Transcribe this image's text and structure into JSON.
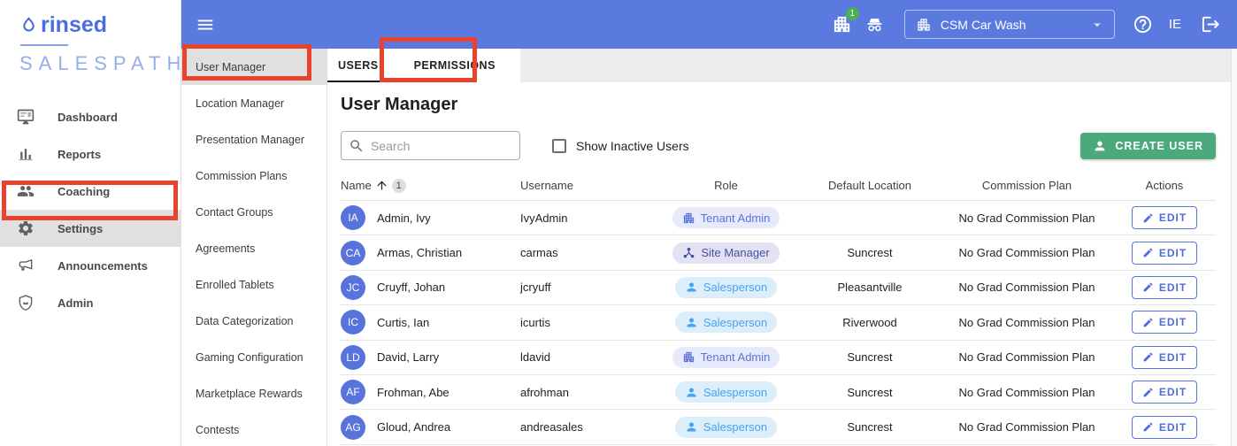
{
  "brand": {
    "name": "rinsed",
    "subtitle": "SALESPATH"
  },
  "sidebar": {
    "items": [
      {
        "id": "dashboard",
        "label": "Dashboard",
        "icon": "dashboard",
        "active": false
      },
      {
        "id": "reports",
        "label": "Reports",
        "icon": "reports",
        "active": false
      },
      {
        "id": "coaching",
        "label": "Coaching",
        "icon": "coaching",
        "active": false
      },
      {
        "id": "settings",
        "label": "Settings",
        "icon": "settings",
        "active": true,
        "annotated": true
      },
      {
        "id": "announcements",
        "label": "Announcements",
        "icon": "announcements",
        "active": false
      },
      {
        "id": "admin",
        "label": "Admin",
        "icon": "admin",
        "active": false
      }
    ]
  },
  "submenu": {
    "items": [
      {
        "id": "user-manager",
        "label": "User Manager",
        "active": true,
        "annotated": true
      },
      {
        "id": "location-manager",
        "label": "Location Manager",
        "active": false
      },
      {
        "id": "presentation-manager",
        "label": "Presentation Manager",
        "active": false
      },
      {
        "id": "commission-plans",
        "label": "Commission Plans",
        "active": false
      },
      {
        "id": "contact-groups",
        "label": "Contact Groups",
        "active": false
      },
      {
        "id": "agreements",
        "label": "Agreements",
        "active": false
      },
      {
        "id": "enrolled-tablets",
        "label": "Enrolled Tablets",
        "active": false
      },
      {
        "id": "data-categorization",
        "label": "Data Categorization",
        "active": false
      },
      {
        "id": "gaming-configuration",
        "label": "Gaming Configuration",
        "active": false
      },
      {
        "id": "marketplace-rewards",
        "label": "Marketplace Rewards",
        "active": false
      },
      {
        "id": "contests",
        "label": "Contests",
        "active": false
      }
    ]
  },
  "topbar": {
    "badge_count": "1",
    "tenant_selector": {
      "value": "CSM Car Wash"
    },
    "user_initials": "IE"
  },
  "tabs": [
    {
      "label": "USERS",
      "active": true
    },
    {
      "label": "PERMISSIONS",
      "active": false,
      "annotated": true
    }
  ],
  "page": {
    "title": "User Manager",
    "search_placeholder": "Search",
    "show_inactive_label": "Show Inactive Users",
    "show_inactive_checked": false,
    "create_user_label": "CREATE USER"
  },
  "table": {
    "columns": [
      "Name",
      "Username",
      "Role",
      "Default Location",
      "Commission Plan",
      "Actions"
    ],
    "sort": {
      "column": "Name",
      "direction": "asc",
      "order": "1"
    },
    "edit_label": "EDIT",
    "role_icons": {
      "tenant-admin": "building",
      "site-manager": "hierarchy",
      "salesperson": "person"
    },
    "rows": [
      {
        "initials": "IA",
        "name": "Admin, Ivy",
        "username": "IvyAdmin",
        "role": "Tenant Admin",
        "role_type": "tenant-admin",
        "location": "",
        "plan": "No Grad Commission Plan"
      },
      {
        "initials": "CA",
        "name": "Armas, Christian",
        "username": "carmas",
        "role": "Site Manager",
        "role_type": "site-manager",
        "location": "Suncrest",
        "plan": "No Grad Commission Plan"
      },
      {
        "initials": "JC",
        "name": "Cruyff, Johan",
        "username": "jcryuff",
        "role": "Salesperson",
        "role_type": "salesperson",
        "location": "Pleasantville",
        "plan": "No Grad Commission Plan"
      },
      {
        "initials": "IC",
        "name": "Curtis, Ian",
        "username": "icurtis",
        "role": "Salesperson",
        "role_type": "salesperson",
        "location": "Riverwood",
        "plan": "No Grad Commission Plan"
      },
      {
        "initials": "LD",
        "name": "David, Larry",
        "username": "ldavid",
        "role": "Tenant Admin",
        "role_type": "tenant-admin",
        "location": "Suncrest",
        "plan": "No Grad Commission Plan"
      },
      {
        "initials": "AF",
        "name": "Frohman, Abe",
        "username": "afrohman",
        "role": "Salesperson",
        "role_type": "salesperson",
        "location": "Suncrest",
        "plan": "No Grad Commission Plan"
      },
      {
        "initials": "AG",
        "name": "Gloud, Andrea",
        "username": "andreasales",
        "role": "Salesperson",
        "role_type": "salesperson",
        "location": "Suncrest",
        "plan": "No Grad Commission Plan"
      }
    ]
  },
  "colors": {
    "topbar_blue": "#5b7ae0",
    "brand_blue": "#4a6ee0",
    "accent_blue": "#5973dc",
    "annotation_red": "#e8432c",
    "create_green": "#4ba97c",
    "badge_green": "#4caf50",
    "tenant_admin_text": "#5b74d8",
    "site_manager_text": "#3e54a3",
    "salesperson_text": "#47a3f2"
  }
}
